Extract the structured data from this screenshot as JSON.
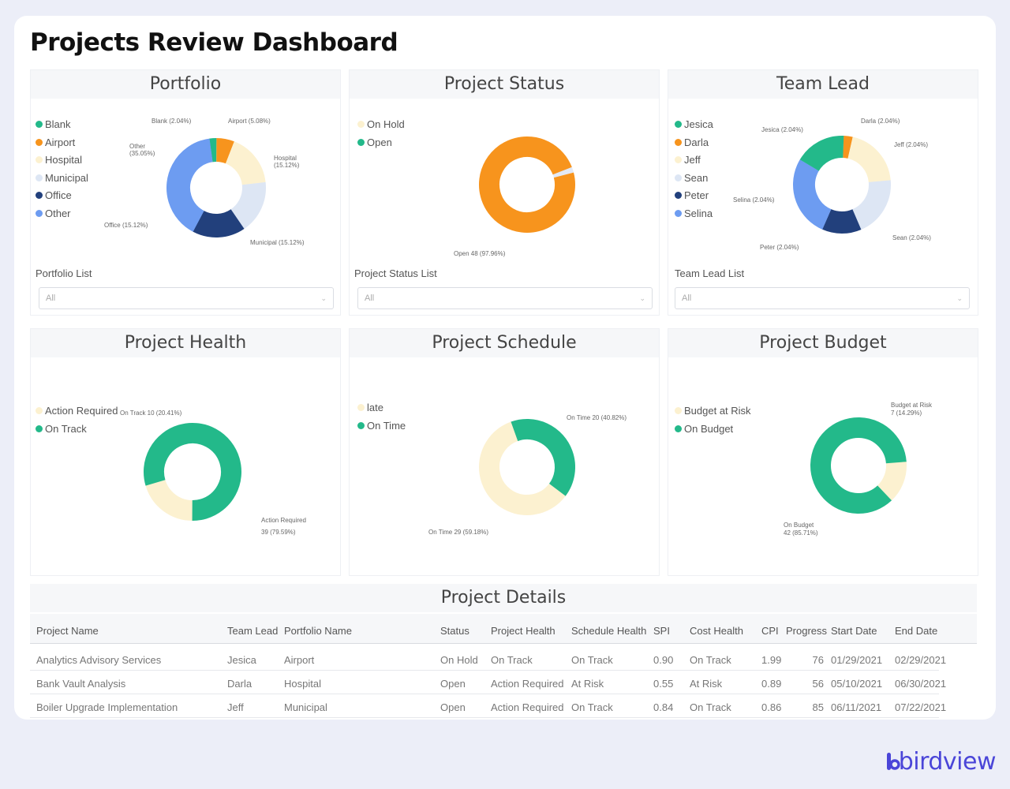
{
  "dashboard": {
    "title": "Projects Review Dashboard"
  },
  "colors": {
    "green": "#23b98a",
    "orange": "#f7941d",
    "cream": "#fcf1d0",
    "lightblue": "#dde6f4",
    "navy": "#22407c",
    "blue": "#6d9cf1",
    "paleblue": "#e3e9f5",
    "teal": "#23b98a"
  },
  "portfolio": {
    "title": "Portfolio",
    "legend": [
      {
        "label": "Blank",
        "color": "#23b98a"
      },
      {
        "label": "Airport",
        "color": "#f7941d"
      },
      {
        "label": "Hospital",
        "color": "#fcf1d0"
      },
      {
        "label": "Municipal",
        "color": "#dde6f4"
      },
      {
        "label": "Office",
        "color": "#22407c"
      },
      {
        "label": "Other",
        "color": "#6d9cf1"
      }
    ],
    "slices": [
      {
        "name": "Blank",
        "value": 2.04,
        "color": "#23b98a"
      },
      {
        "name": "Airport",
        "value": 5.08,
        "color": "#f7941d"
      },
      {
        "name": "Hospital",
        "value": 15.12,
        "color": "#fcf1d0"
      },
      {
        "name": "Municipal",
        "value": 15.12,
        "color": "#dde6f4"
      },
      {
        "name": "Office",
        "value": 15.12,
        "color": "#22407c"
      },
      {
        "name": "Other",
        "value": 35.05,
        "color": "#6d9cf1"
      }
    ],
    "labels": {
      "blank": "Blank (2.04%)",
      "airport": "Airport (5.08%)",
      "hospital_line1": "Hospital",
      "hospital_line2": "(15.12%)",
      "municipal": "Municipal (15.12%)",
      "office": "Office (15.12%)",
      "other_line1": "Other",
      "other_line2": "(35.05%)"
    },
    "list_label": "Portfolio List",
    "select_value": "All"
  },
  "status": {
    "title": "Project Status",
    "legend": [
      {
        "label": "On Hold",
        "color": "#fcf1d0"
      },
      {
        "label": "Open",
        "color": "#23b98a"
      }
    ],
    "slices": [
      {
        "name": "On Hold",
        "value": 2.04,
        "color": "#e3e9f5"
      },
      {
        "name": "Open",
        "value": 97.96,
        "color": "#f7941d"
      }
    ],
    "labels": {
      "open": "Open 48 (97.96%)"
    },
    "list_label": "Project Status List",
    "select_value": "All"
  },
  "teamlead": {
    "title": "Team Lead",
    "legend": [
      {
        "label": "Jesica",
        "color": "#23b98a"
      },
      {
        "label": "Darla",
        "color": "#f7941d"
      },
      {
        "label": "Jeff",
        "color": "#fcf1d0"
      },
      {
        "label": "Sean",
        "color": "#dde6f4"
      },
      {
        "label": "Peter",
        "color": "#22407c"
      },
      {
        "label": "Selina",
        "color": "#6d9cf1"
      }
    ],
    "slices": [
      {
        "name": "Darla",
        "value": 3,
        "color": "#f7941d"
      },
      {
        "name": "Jeff",
        "value": 20,
        "color": "#fcf1d0"
      },
      {
        "name": "Sean",
        "value": 20,
        "color": "#dde6f4"
      },
      {
        "name": "Peter",
        "value": 13,
        "color": "#22407c"
      },
      {
        "name": "Selina",
        "value": 27,
        "color": "#6d9cf1"
      },
      {
        "name": "Jesica",
        "value": 17,
        "color": "#23b98a"
      }
    ],
    "labels": {
      "jesica": "Jesica (2.04%)",
      "darla": "Darla (2.04%)",
      "jeff": "Jeff (2.04%)",
      "selina": "Selina (2.04%)",
      "sean": "Sean (2.04%)",
      "peter": "Peter (2.04%)"
    },
    "list_label": "Team Lead List",
    "select_value": "All"
  },
  "health": {
    "title": "Project Health",
    "legend": [
      {
        "label": "Action Required",
        "color": "#fcf1d0"
      },
      {
        "label": "On Track",
        "color": "#23b98a"
      }
    ],
    "slices": [
      {
        "name": "Action Required",
        "value": 20.41,
        "color": "#fcf1d0"
      },
      {
        "name": "On Track",
        "value": 79.59,
        "color": "#23b98a"
      }
    ],
    "labels": {
      "on_track": "On Track 10 (20.41%)",
      "action_line1": "Action Required",
      "action_line2": "39 (79.59%)"
    }
  },
  "schedule": {
    "title": "Project Schedule",
    "legend": [
      {
        "label": "late",
        "color": "#fcf1d0"
      },
      {
        "label": "On Time",
        "color": "#23b98a"
      }
    ],
    "slices": [
      {
        "name": "On Time",
        "value": 40.82,
        "color": "#23b98a"
      },
      {
        "name": "late",
        "value": 59.18,
        "color": "#fcf1d0"
      }
    ],
    "labels": {
      "on_time_top": "On Time 20 (40.82%)",
      "on_time_bottom": "On Time 29 (59.18%)"
    }
  },
  "budget": {
    "title": "Project Budget",
    "legend": [
      {
        "label": "Budget at Risk",
        "color": "#fcf1d0"
      },
      {
        "label": "On Budget",
        "color": "#23b98a"
      }
    ],
    "slices": [
      {
        "name": "Budget at Risk",
        "value": 14.29,
        "color": "#fcf1d0"
      },
      {
        "name": "On Budget",
        "value": 85.71,
        "color": "#23b98a"
      }
    ],
    "labels": {
      "risk_line1": "Budget at Risk",
      "risk_line2": "7 (14.29%)",
      "onbudget_line1": "On Budget",
      "onbudget_line2": "42 (85.71%)"
    }
  },
  "details": {
    "title": "Project Details",
    "columns": [
      "Project Name",
      "Team Lead",
      "Portfolio Name",
      "Status",
      "Project Health",
      "Schedule Health",
      "SPI",
      "Cost Health",
      "CPI",
      "Progress",
      "Start Date",
      "End Date"
    ],
    "rows": [
      [
        "Analytics Advisory Services",
        "Jesica",
        "Airport",
        "On Hold",
        "On Track",
        "On Track",
        "0.90",
        "On Track",
        "1.99",
        "76",
        "01/29/2021",
        "02/29/2021"
      ],
      [
        "Bank Vault Analysis",
        "Darla",
        "Hospital",
        "Open",
        "Action Required",
        "At Risk",
        "0.55",
        "At Risk",
        "0.89",
        "56",
        "05/10/2021",
        "06/30/2021"
      ],
      [
        "Boiler Upgrade Implementation",
        "Jeff",
        "Municipal",
        "Open",
        "Action Required",
        "On Track",
        "0.84",
        "On Track",
        "0.86",
        "85",
        "06/11/2021",
        "07/22/2021"
      ]
    ]
  },
  "brand": {
    "name": "birdview"
  }
}
